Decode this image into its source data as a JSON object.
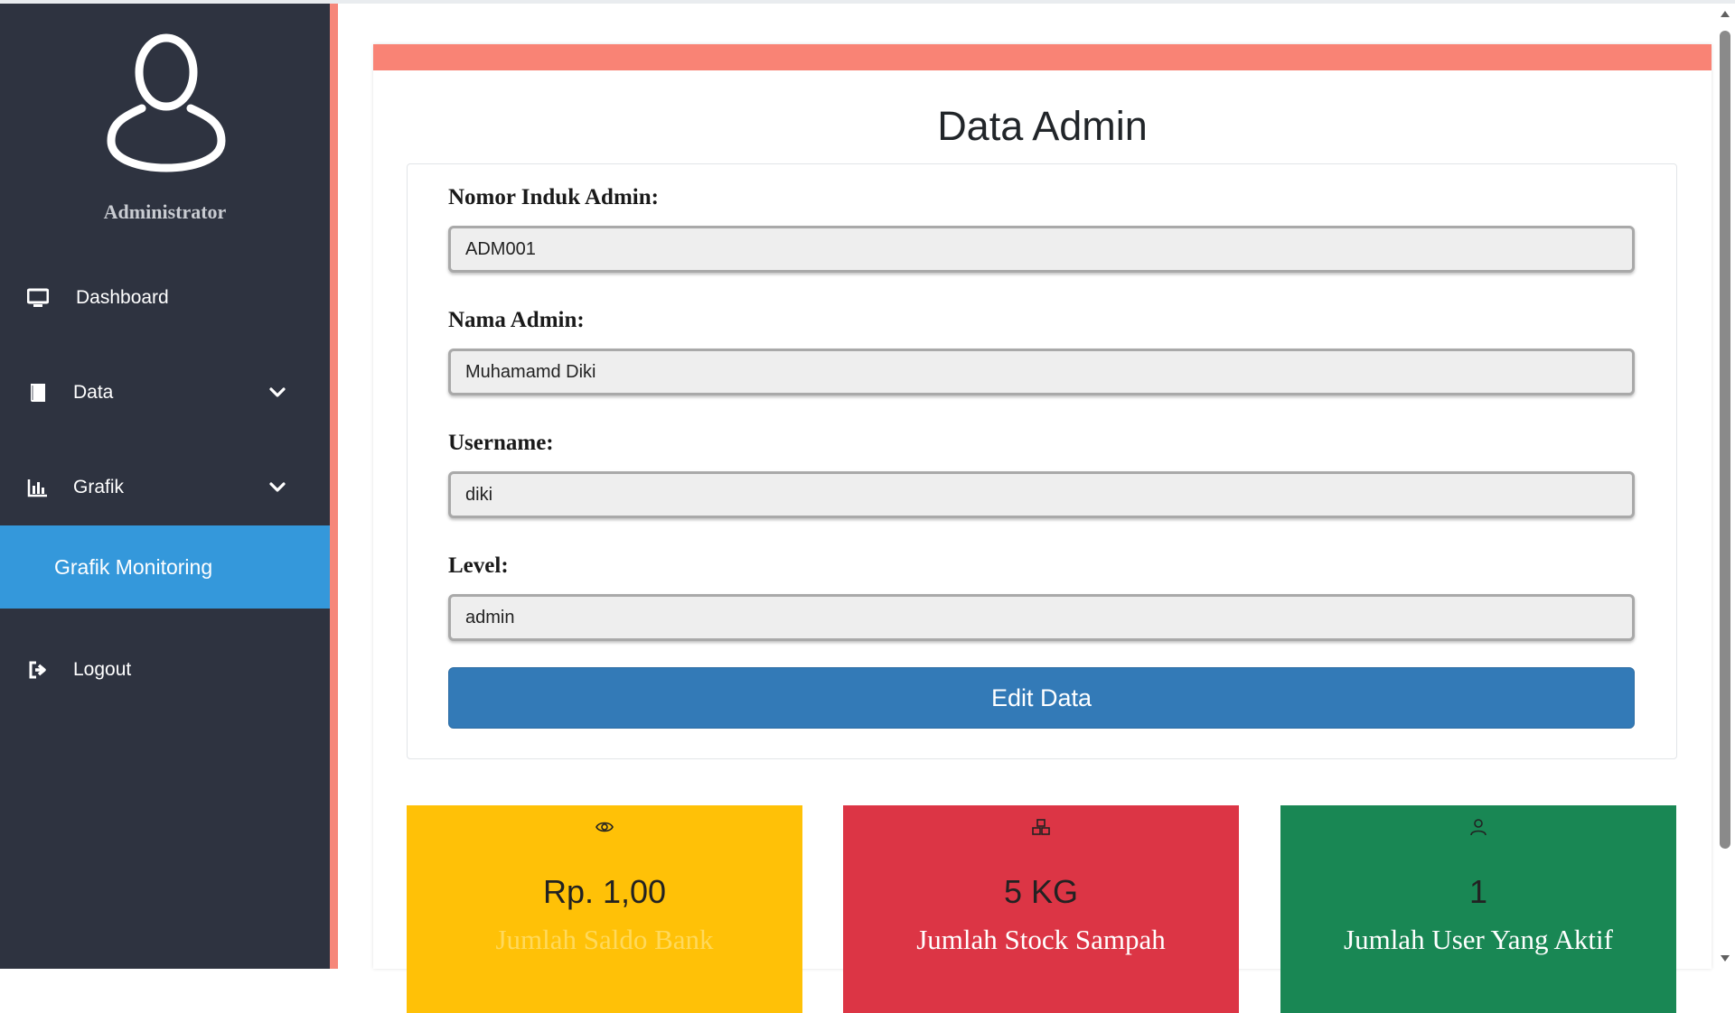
{
  "sidebar": {
    "user_name": "Administrator",
    "menu": {
      "dashboard": "Dashboard",
      "data": "Data",
      "grafik": "Grafik",
      "grafik_monitoring": "Grafik Monitoring",
      "logout": "Logout"
    },
    "colors": {
      "background": "#2e3340",
      "accent": "#f6877a",
      "active": "#3498db"
    }
  },
  "main": {
    "title": "Data Admin",
    "form": {
      "fields": [
        {
          "label": "Nomor Induk Admin:",
          "value": "ADM001"
        },
        {
          "label": "Nama Admin:",
          "value": "Muhamamd Diki"
        },
        {
          "label": "Username:",
          "value": "diki"
        },
        {
          "label": "Level:",
          "value": "admin"
        }
      ],
      "submit_label": "Edit Data"
    },
    "stats": [
      {
        "icon": "eye-icon",
        "value": "Rp. 1,00",
        "label": "Jumlah Saldo Bank",
        "bg": "#ffc107"
      },
      {
        "icon": "boxes-icon",
        "value": "5 KG",
        "label": "Jumlah Stock Sampah",
        "bg": "#dc3545"
      },
      {
        "icon": "person-icon",
        "value": "1",
        "label": "Jumlah User Yang Aktif",
        "bg": "#198754"
      }
    ],
    "colors": {
      "header_bar": "#f98375",
      "button": "#337ab7"
    }
  }
}
